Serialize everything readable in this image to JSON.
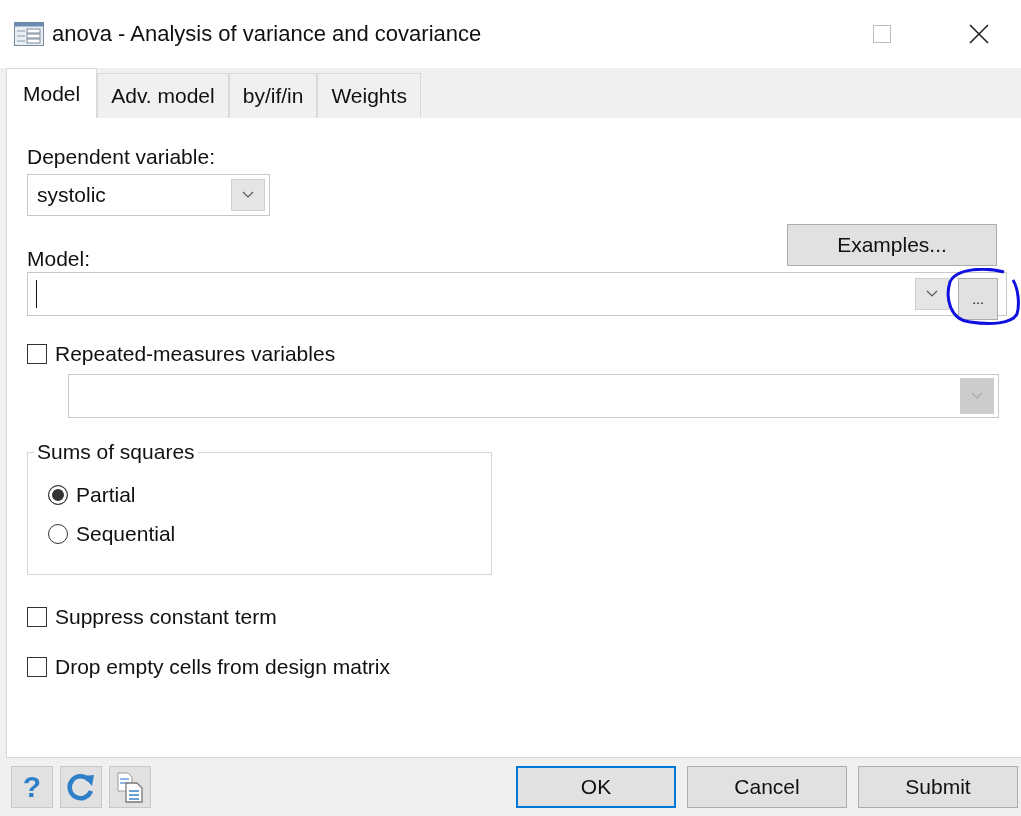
{
  "window": {
    "title": "anova - Analysis of variance and covariance"
  },
  "tabs": [
    {
      "label": "Model",
      "selected": true
    },
    {
      "label": "Adv. model",
      "selected": false
    },
    {
      "label": "by/if/in",
      "selected": false
    },
    {
      "label": "Weights",
      "selected": false
    }
  ],
  "dependent_variable": {
    "label": "Dependent variable:",
    "value": "systolic"
  },
  "examples_button": "Examples...",
  "model": {
    "label": "Model:",
    "browse_button": "...",
    "focused": true
  },
  "repeated_measures": {
    "label": "Repeated-measures variables",
    "checked": false,
    "field_disabled": true
  },
  "sums_of_squares": {
    "title": "Sums of squares",
    "options": [
      {
        "label": "Partial",
        "selected": true
      },
      {
        "label": "Sequential",
        "selected": false
      }
    ]
  },
  "options": [
    {
      "label": "Suppress constant term",
      "checked": false
    },
    {
      "label": "Drop empty cells from design matrix",
      "checked": false
    }
  ],
  "help_button": "?",
  "buttons": [
    {
      "label": "OK",
      "default": true
    },
    {
      "label": "Cancel",
      "default": false
    },
    {
      "label": "Submit",
      "default": false
    }
  ]
}
